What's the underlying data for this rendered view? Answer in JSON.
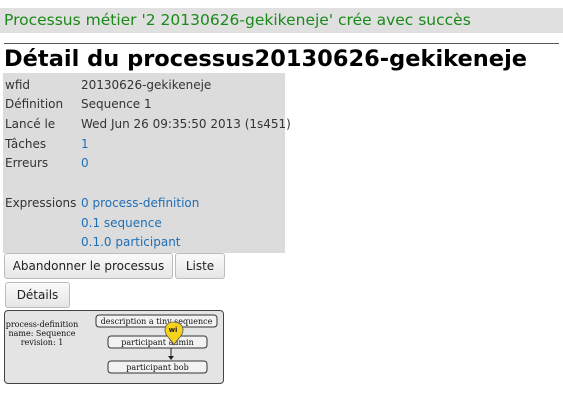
{
  "flash": "Processus métier '2 20130626-gekikeneje' crée avec succès",
  "title": "Détail du processus20130626-gekikeneje",
  "details": {
    "wfid": {
      "label": "wfid",
      "value": "20130626-gekikeneje"
    },
    "definition": {
      "label": "Définition",
      "value": "Sequence 1"
    },
    "launched": {
      "label": "Lancé le",
      "value": "Wed Jun 26 09:35:50 2013 (1s451)"
    },
    "tasks": {
      "label": "Tâches",
      "value": "1"
    },
    "errors": {
      "label": "Erreurs",
      "value": "0"
    },
    "expressions": {
      "label": "Expressions",
      "items": [
        "0 process-definition",
        "0.1 sequence",
        "0.1.0 participant"
      ]
    }
  },
  "buttons": {
    "abandon": "Abandonner le processus",
    "list": "Liste",
    "details": "Détails"
  },
  "diagram": {
    "info": [
      "process-definition",
      "name: Sequence",
      "revision: 1"
    ],
    "node_description": "description a tiny sequence",
    "node_admin": "participant admin",
    "node_bob": "participant bob",
    "marker": "wi",
    "colors": {
      "marker": "#f5d31a",
      "box": "#f2f2f2"
    }
  }
}
